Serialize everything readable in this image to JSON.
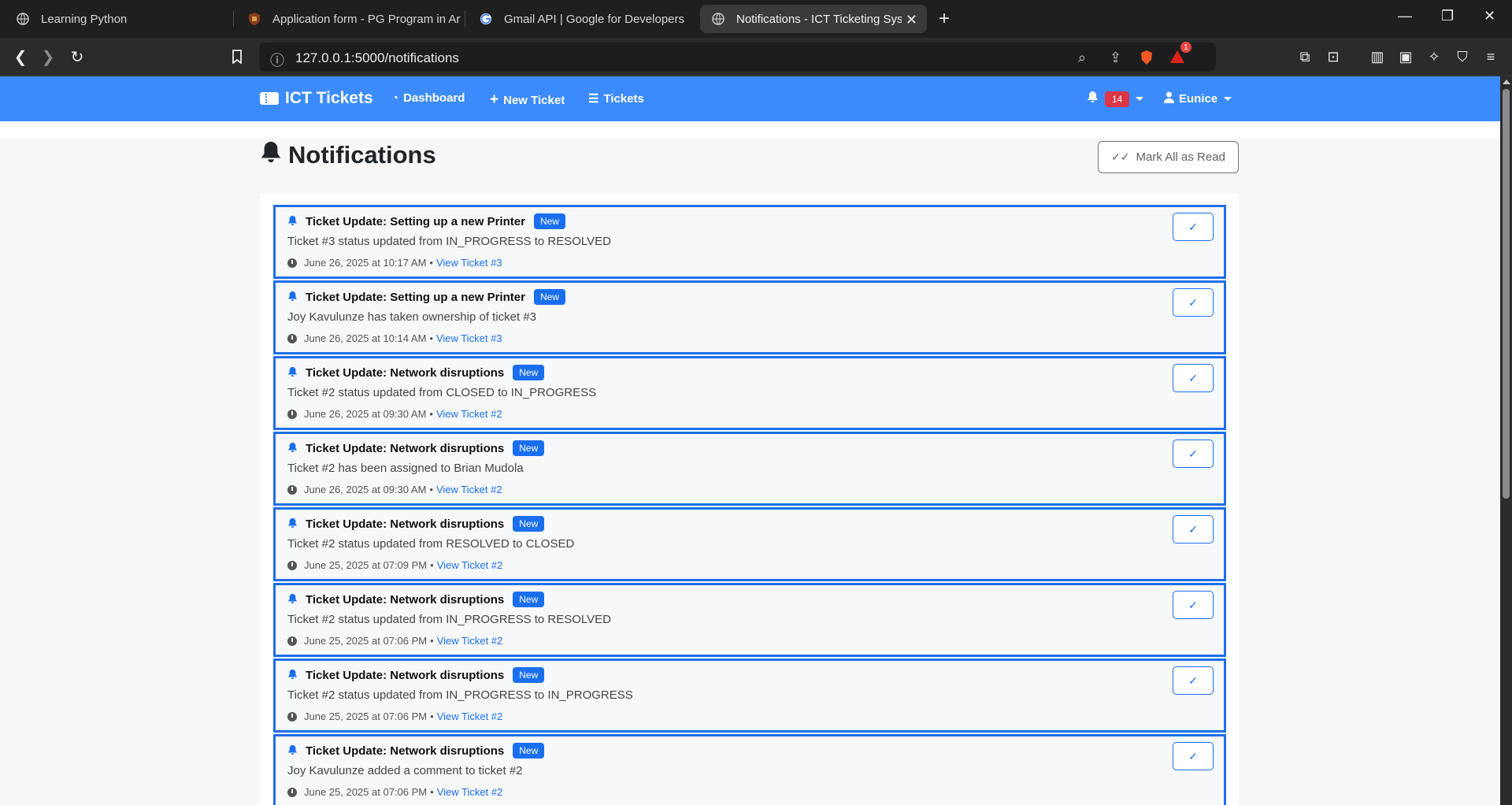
{
  "browser": {
    "tabs": [
      {
        "title": "Learning Python",
        "icon": "globe-icon"
      },
      {
        "title": "Application form - PG Program in Art",
        "icon": "shield-icon"
      },
      {
        "title": "Gmail API  |  Google for Developers",
        "icon": "google-icon"
      },
      {
        "title": "Notifications - ICT Ticketing Syst",
        "icon": "globe-icon"
      }
    ],
    "url": "127.0.0.1:5000/notifications",
    "ext_badge": "1"
  },
  "navbar": {
    "brand": "ICT Tickets",
    "links": [
      "Dashboard",
      "New Ticket",
      "Tickets"
    ],
    "notif_count": "14",
    "user": "Eunice"
  },
  "page": {
    "title": "Notifications",
    "mark_all_label": "Mark All as Read"
  },
  "notifications": [
    {
      "title": "Ticket Update: Setting up a new Printer",
      "badge": "New",
      "message": "Ticket #3 status updated from IN_PROGRESS to RESOLVED",
      "date": "June 26, 2025 at 10:17 AM",
      "sep": "•",
      "link": "View Ticket #3"
    },
    {
      "title": "Ticket Update: Setting up a new Printer",
      "badge": "New",
      "message": "Joy Kavulunze has taken ownership of ticket #3",
      "date": "June 26, 2025 at 10:14 AM",
      "sep": "•",
      "link": "View Ticket #3"
    },
    {
      "title": "Ticket Update: Network disruptions",
      "badge": "New",
      "message": "Ticket #2 status updated from CLOSED to IN_PROGRESS",
      "date": "June 26, 2025 at 09:30 AM",
      "sep": "•",
      "link": "View Ticket #2"
    },
    {
      "title": "Ticket Update: Network disruptions",
      "badge": "New",
      "message": "Ticket #2 has been assigned to Brian Mudola",
      "date": "June 26, 2025 at 09:30 AM",
      "sep": "•",
      "link": "View Ticket #2"
    },
    {
      "title": "Ticket Update: Network disruptions",
      "badge": "New",
      "message": "Ticket #2 status updated from RESOLVED to CLOSED",
      "date": "June 25, 2025 at 07:09 PM",
      "sep": "•",
      "link": "View Ticket #2"
    },
    {
      "title": "Ticket Update: Network disruptions",
      "badge": "New",
      "message": "Ticket #2 status updated from IN_PROGRESS to RESOLVED",
      "date": "June 25, 2025 at 07:06 PM",
      "sep": "•",
      "link": "View Ticket #2"
    },
    {
      "title": "Ticket Update: Network disruptions",
      "badge": "New",
      "message": "Ticket #2 status updated from IN_PROGRESS to IN_PROGRESS",
      "date": "June 25, 2025 at 07:06 PM",
      "sep": "•",
      "link": "View Ticket #2"
    },
    {
      "title": "Ticket Update: Network disruptions",
      "badge": "New",
      "message": "Joy Kavulunze added a comment to ticket #2",
      "date": "June 25, 2025 at 07:06 PM",
      "sep": "•",
      "link": "View Ticket #2"
    }
  ],
  "colors": {
    "navbar": "#3b8bfd",
    "primary": "#1a6ff0",
    "danger": "#dc3545"
  }
}
